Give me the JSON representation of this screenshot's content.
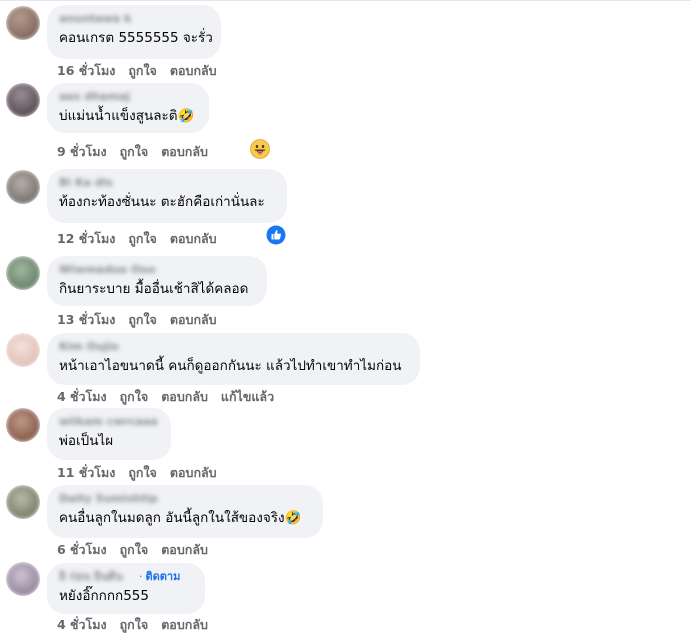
{
  "comments": [
    {
      "author": "anuntawa k",
      "text": "คอนเกรต 5555555 จะรั่ว",
      "time": "16 ชั่วโมง",
      "like": "ถูกใจ",
      "reply": "ตอบกลับ",
      "avatar_color": "#8a6a5c"
    },
    {
      "author": "aas dhamaj",
      "text": "บ่แม่นน้ำแข็งสูนละติ🤣",
      "time": "9 ชั่วโมง",
      "like": "ถูกใจ",
      "reply": "ตอบกลับ",
      "reaction": "grin-emoji",
      "avatar_color": "#5a4a52"
    },
    {
      "author": "Bi Ka dis",
      "text": "ท้องกะท้องซั่นนะ ตะฮักคือเก่านั่นละ",
      "time": "12 ชั่วโมง",
      "like": "ถูกใจ",
      "reply": "ตอบกลับ",
      "reaction": "like-emoji",
      "avatar_color": "#7a7470"
    },
    {
      "author": "Wiwmaduo Ooo",
      "text": "กินยาระบาย มื้ออื่นเช้าสิได้คลอด",
      "time": "13 ชั่วโมง",
      "like": "ถูกใจ",
      "reply": "ตอบกลับ",
      "avatar_color": "#6a8a70"
    },
    {
      "author": "Kim Oujio",
      "text": "หน้าเอาไอขนาดนี้ คนก็ดูออกกันนะ แล้วไปทำเขาทำไมก่อน",
      "time": "4 ชั่วโมง",
      "like": "ถูกใจ",
      "reply": "ตอบกลับ",
      "edited": "แก้ไขแล้ว",
      "avatar_color": "#e6c9c2"
    },
    {
      "author": "wiikam cwrcaaa",
      "text": "พ่อเป็นไผ",
      "time": "11 ชั่วโมง",
      "like": "ถูกใจ",
      "reply": "ตอบกลับ",
      "avatar_color": "#8a5f4f"
    },
    {
      "author": "Daity Sumishtip",
      "text": "คนอื่นลูกในมดลูก อันนี้ลูกในใส้ของจริง🤣",
      "time": "6 ชั่วโมง",
      "like": "ถูกใจ",
      "reply": "ตอบกลับ",
      "avatar_color": "#7d8470"
    },
    {
      "author": "อิ ก่อน อินดิน",
      "follow": "ติดตาม",
      "text": "หยังอิ๊กกกก555",
      "time": "4 ชั่วโมง",
      "like": "ถูกใจ",
      "reply": "ตอบกลับ",
      "avatar_color": "#9a8aa0"
    }
  ],
  "colors": {
    "bubble": "#f0f2f5",
    "meta_text": "#65676b",
    "link_blue": "#1b74e4"
  }
}
